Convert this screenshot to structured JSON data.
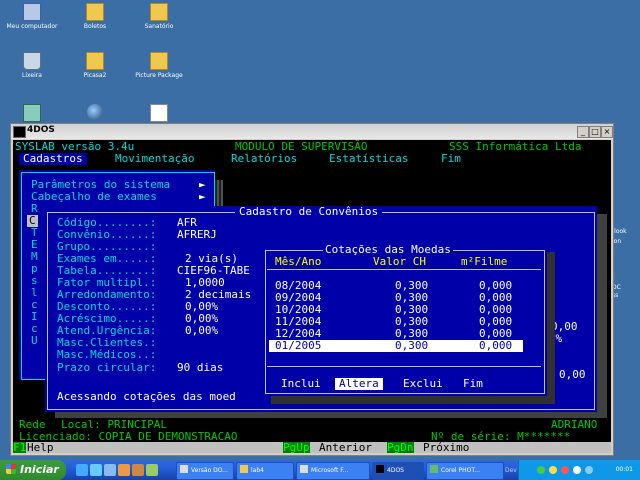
{
  "desktop": {
    "icons": [
      {
        "label": "Meu computador"
      },
      {
        "label": "Boletos"
      },
      {
        "label": "Sanatório"
      },
      {
        "label": "Lixeira"
      },
      {
        "label": "Picasa2"
      },
      {
        "label": "Picture Package"
      }
    ],
    "right_labels": [
      "utlook",
      "ition",
      "DC",
      "ss"
    ]
  },
  "window": {
    "title": "4DOS",
    "min": "_",
    "max": "□",
    "close": "×"
  },
  "app": {
    "header_left": "SYSLAB versão 3.4u",
    "header_mid": "MODULO DE SUPERVISÃO",
    "header_right": "SSS Informática Ltda",
    "menu": [
      "Cadastros",
      "Movimentação",
      "Relatórios",
      "Estatísticas",
      "Fim"
    ],
    "cad_menu": [
      {
        "label": "Parâmetros do sistema",
        "arrow": "►"
      },
      {
        "label": "Cabeçalho de exames",
        "arrow": "►"
      }
    ],
    "cad_menu_letters": [
      "R",
      "C",
      "T",
      "E",
      "M",
      "p",
      "s",
      "l",
      "c",
      "I",
      "c",
      "U"
    ],
    "convenio": {
      "title": "Cadastro de Convênios",
      "fields": [
        {
          "label": "Código........:",
          "value": "AFR"
        },
        {
          "label": "Convênio......:",
          "value": "AFRERJ"
        },
        {
          "label": "Grupo.........:",
          "value": ""
        },
        {
          "label": "Exames em.....:",
          "value": "2 via(s)"
        },
        {
          "label": "Tabela........:",
          "value": "CIEF96-TABE"
        },
        {
          "label": "Fator multipl.:",
          "value": "1,0000"
        },
        {
          "label": "Arredondamento:",
          "value": "2 decimais"
        },
        {
          "label": "Desconto......:",
          "value": "0,00%"
        },
        {
          "label": "Acréscimo.....:",
          "value": "0,00%"
        },
        {
          "label": "Atend.Urgência:",
          "value": "0,00%"
        },
        {
          "label": "Masc.Clientes.:",
          "value": ""
        },
        {
          "label": "Masc.Médicos..:",
          "value": ""
        },
        {
          "label": "Prazo circular:",
          "value": "90 dias"
        }
      ],
      "status": "Acessando cotações das moed",
      "right_frag": [
        "ão",
        "ão",
        "ão"
      ],
      "right_vals": [
        "0,00",
        "0,00%",
        "im",
        "0,00"
      ]
    },
    "cotacoes": {
      "title": "Cotações das Moedas",
      "headers": [
        "Mês/Ano",
        "Valor CH",
        "m²Filme"
      ],
      "rows": [
        {
          "mes": "08/2004",
          "ch": "0,300",
          "filme": "0,000"
        },
        {
          "mes": "09/2004",
          "ch": "0,300",
          "filme": "0,000"
        },
        {
          "mes": "10/2004",
          "ch": "0,300",
          "filme": "0,000"
        },
        {
          "mes": "11/2004",
          "ch": "0,300",
          "filme": "0,000"
        },
        {
          "mes": "12/2004",
          "ch": "0,300",
          "filme": "0,000"
        },
        {
          "mes": "01/2005",
          "ch": "0,300",
          "filme": "0,000"
        }
      ],
      "actions": [
        "Inclui",
        "Altera",
        "Exclui",
        "Fim"
      ]
    },
    "footer": {
      "rede_label": "Rede",
      "rede_value": "Local: PRINCIPAL",
      "user": "ADRIANO",
      "licenciado": "Licenciado: COPIA DE DEMONSTRACAO",
      "serie": "Nº de série: M*******",
      "f1": "F1",
      "help": "Help",
      "pgup": "PgUp",
      "anterior": "Anterior",
      "pgdn": "PgDn",
      "proximo": "Próximo"
    }
  },
  "taskbar": {
    "start": "Iniciar",
    "buttons": [
      "Versão DO...",
      "lab4",
      "Microsoft F...",
      "4DOS",
      "Corel PHOT...",
      "Dev"
    ],
    "clock": "00:01"
  }
}
